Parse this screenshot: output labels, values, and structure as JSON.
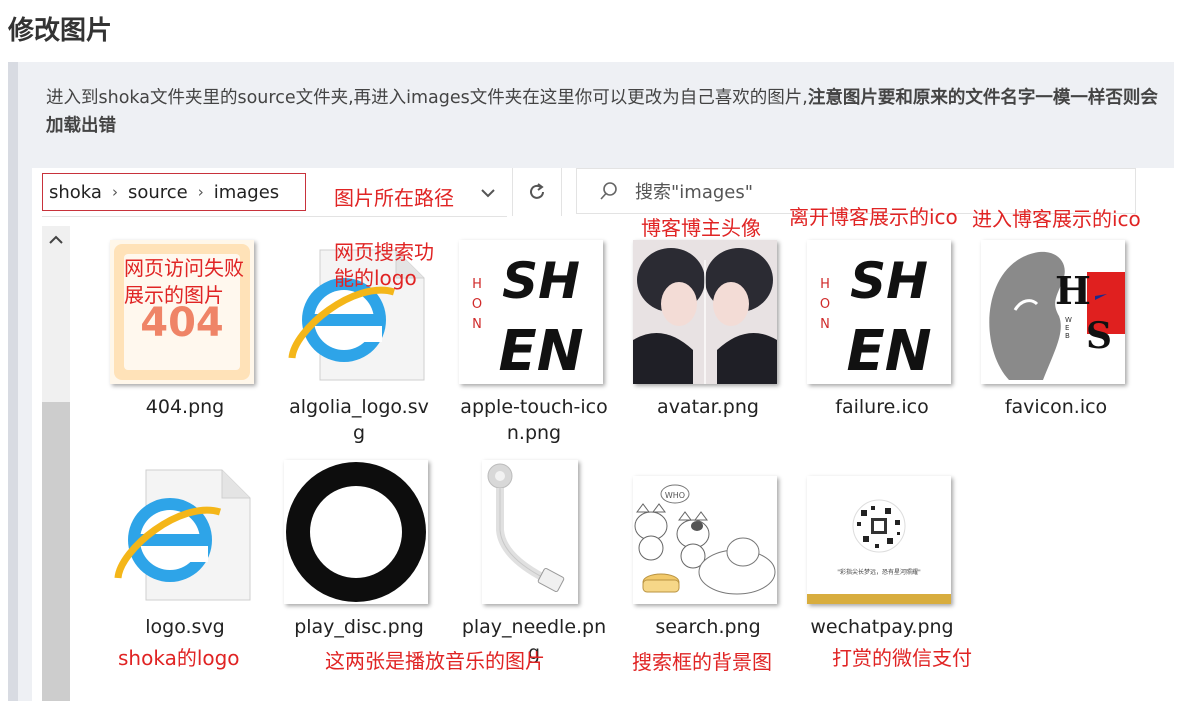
{
  "page_title": "修改图片",
  "note": {
    "text": "进入到shoka文件夹里的source文件夹,再进入images文件夹在这里你可以更改为自己喜欢的图片,",
    "bold": "注意图片要和原来的文件名字一模一样否则会加载出错"
  },
  "explorer": {
    "breadcrumb": [
      "shoka",
      "source",
      "images"
    ],
    "search_placeholder": "搜索\"images\"",
    "files": [
      {
        "name": "404.png",
        "thumb_text": "404"
      },
      {
        "name": "algolia_logo.svg"
      },
      {
        "name": "apple-touch-icon.png",
        "thumb_text_top": "SH",
        "thumb_text_bottom": "EN",
        "thumb_side": "HON"
      },
      {
        "name": "avatar.png"
      },
      {
        "name": "failure.ico",
        "thumb_text_top": "SH",
        "thumb_text_bottom": "EN",
        "thumb_side": "HON"
      },
      {
        "name": "favicon.ico",
        "thumb_letter_h": "H",
        "thumb_letter_s": "S",
        "thumb_side": "WEB"
      },
      {
        "name": "logo.svg"
      },
      {
        "name": "play_disc.png"
      },
      {
        "name": "play_needle.png"
      },
      {
        "name": "search.png",
        "thumb_bubble": "WHO"
      },
      {
        "name": "wechatpay.png",
        "thumb_caption": "\"彩指尖长梦远，恐有星河照耀\""
      }
    ]
  },
  "annotations": {
    "path": "图片所在路径",
    "fail_1": "网页访问失败",
    "fail_2": "展示的图片",
    "search_logo_1": "网页搜索功",
    "search_logo_2": "能的logo",
    "avatar": "博客博主头像",
    "leave_ico": "离开博客展示的ico",
    "enter_ico": "进入博客展示的ico",
    "logo": "shoka的logo",
    "music": "这两张是播放音乐的图片",
    "search_bg": "搜索框的背景图",
    "wechat": "打赏的微信支付"
  },
  "colors": {
    "annotation": "#e02424",
    "note_bg": "#eef0f4",
    "note_border": "#d8dbe2",
    "path_box": "#c8323b"
  },
  "icons": [
    "chevron-right-icon",
    "chevron-down-icon",
    "refresh-icon",
    "search-icon",
    "scroll-up-icon",
    "ie-file-icon"
  ]
}
